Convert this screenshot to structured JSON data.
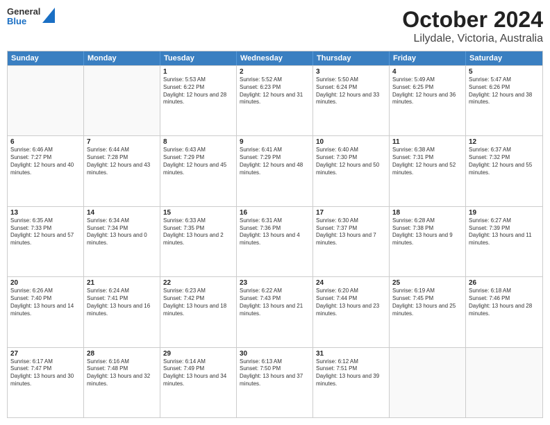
{
  "logo": {
    "general": "General",
    "blue": "Blue"
  },
  "title": "October 2024",
  "subtitle": "Lilydale, Victoria, Australia",
  "header_days": [
    "Sunday",
    "Monday",
    "Tuesday",
    "Wednesday",
    "Thursday",
    "Friday",
    "Saturday"
  ],
  "weeks": [
    [
      {
        "day": "",
        "empty": true
      },
      {
        "day": "",
        "empty": true
      },
      {
        "day": "1",
        "sunrise": "Sunrise: 5:53 AM",
        "sunset": "Sunset: 6:22 PM",
        "daylight": "Daylight: 12 hours and 28 minutes."
      },
      {
        "day": "2",
        "sunrise": "Sunrise: 5:52 AM",
        "sunset": "Sunset: 6:23 PM",
        "daylight": "Daylight: 12 hours and 31 minutes."
      },
      {
        "day": "3",
        "sunrise": "Sunrise: 5:50 AM",
        "sunset": "Sunset: 6:24 PM",
        "daylight": "Daylight: 12 hours and 33 minutes."
      },
      {
        "day": "4",
        "sunrise": "Sunrise: 5:49 AM",
        "sunset": "Sunset: 6:25 PM",
        "daylight": "Daylight: 12 hours and 36 minutes."
      },
      {
        "day": "5",
        "sunrise": "Sunrise: 5:47 AM",
        "sunset": "Sunset: 6:26 PM",
        "daylight": "Daylight: 12 hours and 38 minutes."
      }
    ],
    [
      {
        "day": "6",
        "sunrise": "Sunrise: 6:46 AM",
        "sunset": "Sunset: 7:27 PM",
        "daylight": "Daylight: 12 hours and 40 minutes."
      },
      {
        "day": "7",
        "sunrise": "Sunrise: 6:44 AM",
        "sunset": "Sunset: 7:28 PM",
        "daylight": "Daylight: 12 hours and 43 minutes."
      },
      {
        "day": "8",
        "sunrise": "Sunrise: 6:43 AM",
        "sunset": "Sunset: 7:29 PM",
        "daylight": "Daylight: 12 hours and 45 minutes."
      },
      {
        "day": "9",
        "sunrise": "Sunrise: 6:41 AM",
        "sunset": "Sunset: 7:29 PM",
        "daylight": "Daylight: 12 hours and 48 minutes."
      },
      {
        "day": "10",
        "sunrise": "Sunrise: 6:40 AM",
        "sunset": "Sunset: 7:30 PM",
        "daylight": "Daylight: 12 hours and 50 minutes."
      },
      {
        "day": "11",
        "sunrise": "Sunrise: 6:38 AM",
        "sunset": "Sunset: 7:31 PM",
        "daylight": "Daylight: 12 hours and 52 minutes."
      },
      {
        "day": "12",
        "sunrise": "Sunrise: 6:37 AM",
        "sunset": "Sunset: 7:32 PM",
        "daylight": "Daylight: 12 hours and 55 minutes."
      }
    ],
    [
      {
        "day": "13",
        "sunrise": "Sunrise: 6:35 AM",
        "sunset": "Sunset: 7:33 PM",
        "daylight": "Daylight: 12 hours and 57 minutes."
      },
      {
        "day": "14",
        "sunrise": "Sunrise: 6:34 AM",
        "sunset": "Sunset: 7:34 PM",
        "daylight": "Daylight: 13 hours and 0 minutes."
      },
      {
        "day": "15",
        "sunrise": "Sunrise: 6:33 AM",
        "sunset": "Sunset: 7:35 PM",
        "daylight": "Daylight: 13 hours and 2 minutes."
      },
      {
        "day": "16",
        "sunrise": "Sunrise: 6:31 AM",
        "sunset": "Sunset: 7:36 PM",
        "daylight": "Daylight: 13 hours and 4 minutes."
      },
      {
        "day": "17",
        "sunrise": "Sunrise: 6:30 AM",
        "sunset": "Sunset: 7:37 PM",
        "daylight": "Daylight: 13 hours and 7 minutes."
      },
      {
        "day": "18",
        "sunrise": "Sunrise: 6:28 AM",
        "sunset": "Sunset: 7:38 PM",
        "daylight": "Daylight: 13 hours and 9 minutes."
      },
      {
        "day": "19",
        "sunrise": "Sunrise: 6:27 AM",
        "sunset": "Sunset: 7:39 PM",
        "daylight": "Daylight: 13 hours and 11 minutes."
      }
    ],
    [
      {
        "day": "20",
        "sunrise": "Sunrise: 6:26 AM",
        "sunset": "Sunset: 7:40 PM",
        "daylight": "Daylight: 13 hours and 14 minutes."
      },
      {
        "day": "21",
        "sunrise": "Sunrise: 6:24 AM",
        "sunset": "Sunset: 7:41 PM",
        "daylight": "Daylight: 13 hours and 16 minutes."
      },
      {
        "day": "22",
        "sunrise": "Sunrise: 6:23 AM",
        "sunset": "Sunset: 7:42 PM",
        "daylight": "Daylight: 13 hours and 18 minutes."
      },
      {
        "day": "23",
        "sunrise": "Sunrise: 6:22 AM",
        "sunset": "Sunset: 7:43 PM",
        "daylight": "Daylight: 13 hours and 21 minutes."
      },
      {
        "day": "24",
        "sunrise": "Sunrise: 6:20 AM",
        "sunset": "Sunset: 7:44 PM",
        "daylight": "Daylight: 13 hours and 23 minutes."
      },
      {
        "day": "25",
        "sunrise": "Sunrise: 6:19 AM",
        "sunset": "Sunset: 7:45 PM",
        "daylight": "Daylight: 13 hours and 25 minutes."
      },
      {
        "day": "26",
        "sunrise": "Sunrise: 6:18 AM",
        "sunset": "Sunset: 7:46 PM",
        "daylight": "Daylight: 13 hours and 28 minutes."
      }
    ],
    [
      {
        "day": "27",
        "sunrise": "Sunrise: 6:17 AM",
        "sunset": "Sunset: 7:47 PM",
        "daylight": "Daylight: 13 hours and 30 minutes."
      },
      {
        "day": "28",
        "sunrise": "Sunrise: 6:16 AM",
        "sunset": "Sunset: 7:48 PM",
        "daylight": "Daylight: 13 hours and 32 minutes."
      },
      {
        "day": "29",
        "sunrise": "Sunrise: 6:14 AM",
        "sunset": "Sunset: 7:49 PM",
        "daylight": "Daylight: 13 hours and 34 minutes."
      },
      {
        "day": "30",
        "sunrise": "Sunrise: 6:13 AM",
        "sunset": "Sunset: 7:50 PM",
        "daylight": "Daylight: 13 hours and 37 minutes."
      },
      {
        "day": "31",
        "sunrise": "Sunrise: 6:12 AM",
        "sunset": "Sunset: 7:51 PM",
        "daylight": "Daylight: 13 hours and 39 minutes."
      },
      {
        "day": "",
        "empty": true
      },
      {
        "day": "",
        "empty": true
      }
    ]
  ]
}
